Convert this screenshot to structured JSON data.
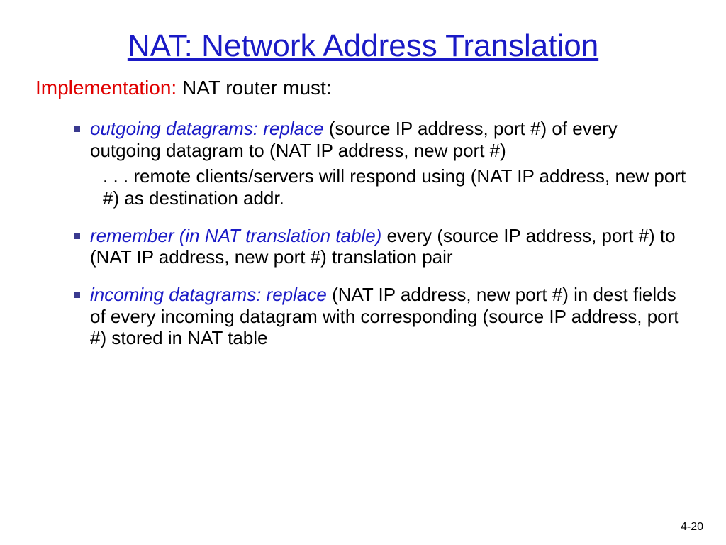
{
  "title": "NAT: Network Address Translation",
  "lead": {
    "red": "Implementation:",
    "rest": " NAT router must:"
  },
  "bullets": [
    {
      "blue": "outgoing datagrams: replace",
      "rest": " (source IP address, port #) of every outgoing datagram to (NAT IP address, new port #)",
      "sub": ". . . remote clients/servers will respond using (NAT IP address, new port #) as destination addr."
    },
    {
      "blue": "remember (in NAT translation table)",
      "rest": " every (source IP address, port #)  to (NAT IP address, new port #) translation pair"
    },
    {
      "blue": "incoming datagrams: replace",
      "rest": " (NAT IP address, new port #) in dest fields of every incoming datagram with corresponding (source IP address, port #) stored in NAT table"
    }
  ],
  "page_num": "4-20"
}
